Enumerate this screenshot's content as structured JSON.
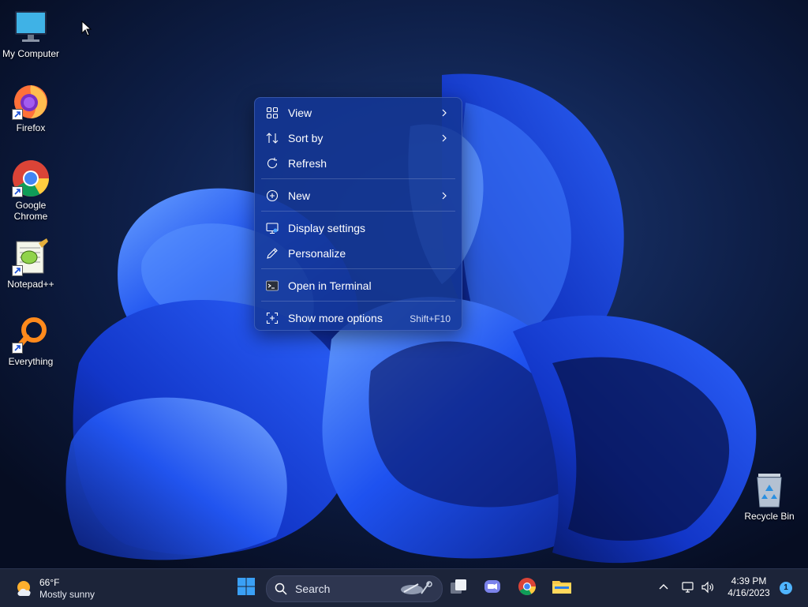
{
  "desktop": {
    "icons": [
      {
        "label": "My Computer",
        "icon": "monitor-icon"
      },
      {
        "label": "Firefox",
        "icon": "firefox-icon"
      },
      {
        "label": "Google Chrome",
        "icon": "chrome-icon"
      },
      {
        "label": "Notepad++",
        "icon": "notepadpp-icon"
      },
      {
        "label": "Everything",
        "icon": "everything-icon"
      },
      {
        "label": "Recycle Bin",
        "icon": "recycle-bin-icon"
      }
    ]
  },
  "context_menu": {
    "items": [
      {
        "label": "View",
        "icon": "grid-icon",
        "submenu": true
      },
      {
        "label": "Sort by",
        "icon": "sort-icon",
        "submenu": true
      },
      {
        "label": "Refresh",
        "icon": "refresh-icon",
        "submenu": false
      },
      {
        "label": "New",
        "icon": "plus-circle-icon",
        "submenu": true
      },
      {
        "label": "Display settings",
        "icon": "display-icon",
        "submenu": false
      },
      {
        "label": "Personalize",
        "icon": "pen-icon",
        "submenu": false
      },
      {
        "label": "Open in Terminal",
        "icon": "terminal-icon",
        "submenu": false
      },
      {
        "label": "Show more options",
        "icon": "more-options-icon",
        "submenu": false,
        "shortcut": "Shift+F10"
      }
    ]
  },
  "taskbar": {
    "weather": {
      "temp": "66°F",
      "desc": "Mostly sunny",
      "icon": "weather-sunny-cloud-icon"
    },
    "search": {
      "label": "Search"
    },
    "apps": [
      "windows-start-icon",
      "task-view-icon",
      "teams-chat-icon",
      "chrome-icon",
      "file-explorer-icon"
    ],
    "tray": {
      "time": "4:39 PM",
      "date": "4/16/2023",
      "notifications": "1"
    }
  },
  "colors": {
    "wallpaper_bg": "#0a1430",
    "bloom_blue": "#1c4ff0",
    "menu_bg": "#14379a",
    "taskbar_bg": "#1c2439"
  }
}
